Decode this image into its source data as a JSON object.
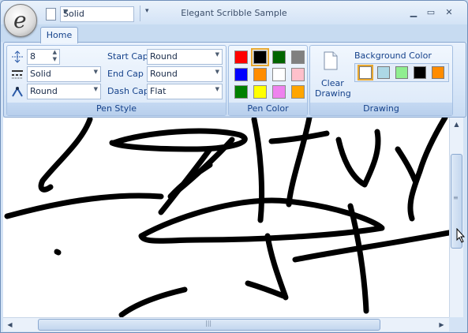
{
  "app": {
    "title": "Elegant Scribble Sample",
    "orb_letter": "e",
    "qat_combo_value": "Solid"
  },
  "tabs": [
    {
      "label": "Home"
    }
  ],
  "pen_style": {
    "group_label": "Pen Style",
    "width_value": "8",
    "dash_style": "Solid",
    "line_join": "Round",
    "start_cap_label": "Start Cap",
    "start_cap_value": "Round",
    "end_cap_label": "End Cap",
    "end_cap_value": "Round",
    "dash_cap_label": "Dash Cap",
    "dash_cap_value": "Flat"
  },
  "pen_color": {
    "group_label": "Pen Color",
    "swatches": [
      "#ff0000",
      "#000000",
      "#006400",
      "#808080",
      "#0000ff",
      "#ff8c00",
      "#ffffff",
      "#ffc0cb",
      "#008000",
      "#ffff00",
      "#ee82ee",
      "#ffa500"
    ],
    "selected_index": 1
  },
  "drawing": {
    "group_label": "Drawing",
    "clear_label_line1": "Clear",
    "clear_label_line2": "Drawing",
    "background_color_label": "Background Color",
    "bg_swatches": [
      "#ffffff",
      "#add8e6",
      "#90ee90",
      "#000000",
      "#ff8c00"
    ],
    "bg_selected_index": 0
  },
  "colors": {
    "ribbon_text": "#15428b",
    "selected_outline": "#e8a830",
    "ink": "#000000"
  },
  "icons": {
    "qat_document": "document-icon",
    "qat_customize": "chevron-down-icon",
    "minimize": "minimize-icon",
    "maximize": "maximize-icon",
    "close": "close-icon",
    "pen_width": "pen-width-icon",
    "dash_style": "dash-style-icon",
    "line_join": "line-join-icon",
    "clear_drawing": "page-icon",
    "cursor": "arrow-cursor-icon"
  }
}
